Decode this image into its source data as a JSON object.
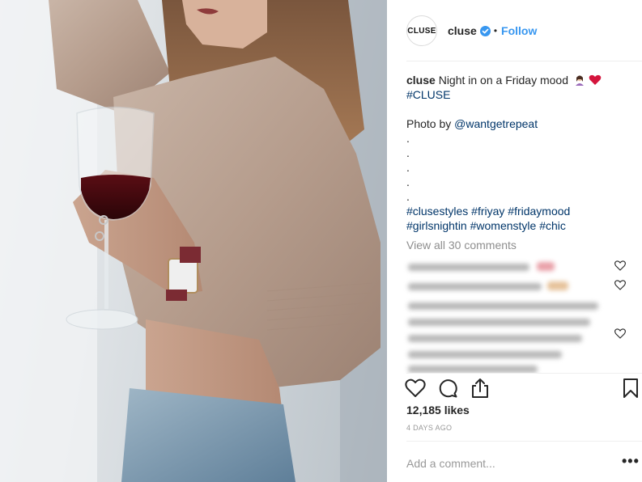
{
  "post": {
    "avatar_text": "CLUSE",
    "username": "cluse",
    "follow_label": "Follow",
    "separator": "•"
  },
  "caption": {
    "username": "cluse",
    "text": "Night in on a Friday mood",
    "hashtag_line1": "#CLUSE",
    "photo_by_prefix": "Photo by",
    "photo_by_handle": "@wantgetrepeat",
    "dots": [
      ".",
      ".",
      ".",
      ".",
      "."
    ],
    "hashtags_line2": [
      "#clusestyles",
      "#friyay",
      "#fridaymood"
    ],
    "hashtags_line3": [
      "#girlsnightin",
      "#womenstyle",
      "#chic"
    ]
  },
  "comments": {
    "view_all_label": "View all 30 comments"
  },
  "stats": {
    "likes": "12,185 likes",
    "time": "4 DAYS AGO"
  },
  "comment_box": {
    "placeholder": "Add a comment...",
    "more_label": "•••"
  },
  "icons": {
    "verified": "verified-badge-icon",
    "like": "heart-icon",
    "comment": "comment-bubble-icon",
    "share": "share-icon",
    "save": "bookmark-icon"
  },
  "colors": {
    "link_blue": "#3897f0",
    "hashtag": "#003569",
    "muted": "#8e8e8e",
    "text": "#262626"
  }
}
